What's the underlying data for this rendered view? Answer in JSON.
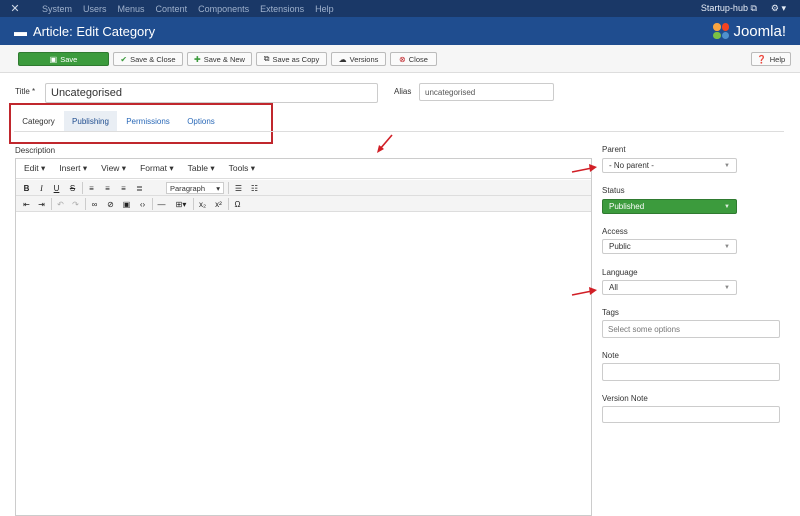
{
  "topnav": {
    "items": [
      "System",
      "Users",
      "Menus",
      "Content",
      "Components",
      "Extensions",
      "Help"
    ],
    "site_name": "Startup-hub"
  },
  "titlebar": {
    "title": "Article: Edit Category",
    "brand": "Joomla!"
  },
  "toolbar": {
    "save": "Save",
    "save_close": "Save & Close",
    "save_new": "Save & New",
    "save_copy": "Save as Copy",
    "versions": "Versions",
    "close": "Close",
    "help": "Help"
  },
  "form": {
    "title_label": "Title *",
    "title_value": "Uncategorised",
    "alias_label": "Alias",
    "alias_value": "uncategorised"
  },
  "tabs": [
    "Category",
    "Publishing",
    "Permissions",
    "Options"
  ],
  "editor": {
    "description_label": "Description",
    "menus": [
      "Edit ▾",
      "Insert ▾",
      "View ▾",
      "Format ▾",
      "Table ▾",
      "Tools ▾"
    ],
    "paragraph": "Paragraph"
  },
  "sidebar": {
    "parent_label": "Parent",
    "parent_value": "- No parent -",
    "status_label": "Status",
    "status_value": "Published",
    "access_label": "Access",
    "access_value": "Public",
    "language_label": "Language",
    "language_value": "All",
    "tags_label": "Tags",
    "tags_placeholder": "Select some options",
    "note_label": "Note",
    "version_note_label": "Version Note"
  },
  "colors": {
    "nav": "#1a3867",
    "titlebar": "#1f4d8f",
    "save": "#3c9b3d",
    "highlight": "#c0272d"
  }
}
